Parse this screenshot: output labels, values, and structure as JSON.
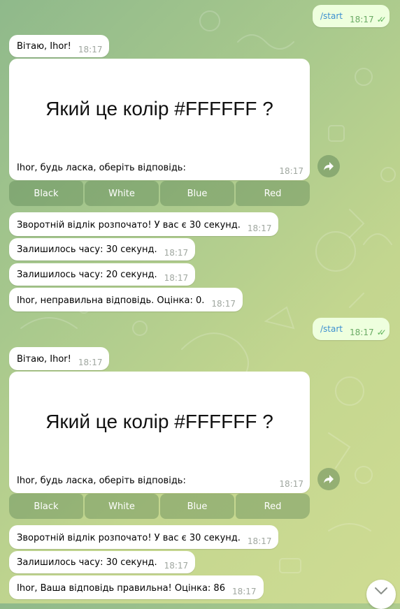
{
  "colors": {
    "accent": "#3c8fd0",
    "bubble_in": "#ffffff",
    "bubble_out": "#eeffde",
    "check": "#5fb35a"
  },
  "messages": {
    "start_1": {
      "text": "/start",
      "time": "18:17",
      "read": "✓✓"
    },
    "greet_1": {
      "text": "Вітаю, Ihor!",
      "time": "18:17"
    },
    "card_1": {
      "question": "Який це колір #FFFFFF ?",
      "caption": "Ihor, будь ласка, оберіть відповідь:",
      "time": "18:17"
    },
    "buttons_1": [
      "Black",
      "White",
      "Blue",
      "Red"
    ],
    "countdown_1": {
      "text": "Зворотній відлік розпочато! У вас є 30 секунд.",
      "time": "18:17"
    },
    "left30_1": {
      "text": "Залишилось часу: 30 секунд.",
      "time": "18:17"
    },
    "left20_1": {
      "text": "Залишилось часу: 20 секунд.",
      "time": "18:17"
    },
    "wrong_1": {
      "text": "Ihor, неправильна відповідь. Оцінка: 0.",
      "time": "18:17"
    },
    "start_2": {
      "text": "/start",
      "time": "18:17",
      "read": "✓✓"
    },
    "greet_2": {
      "text": "Вітаю, Ihor!",
      "time": "18:17"
    },
    "card_2": {
      "question": "Який це колір #FFFFFF ?",
      "caption": "Ihor, будь ласка, оберіть відповідь:",
      "time": "18:17"
    },
    "buttons_2": [
      "Black",
      "White",
      "Blue",
      "Red"
    ],
    "countdown_2": {
      "text": "Зворотній відлік розпочато! У вас є 30 секунд.",
      "time": "18:17"
    },
    "left30_2": {
      "text": "Залишилось часу: 30 секунд.",
      "time": "18:17"
    },
    "right_2": {
      "text": "Ihor, Ваша відповідь правильна! Оцінка: 86",
      "time": "18:17"
    }
  },
  "icons": {
    "share": "share-arrow-icon",
    "scroll": "chevron-down-icon"
  }
}
